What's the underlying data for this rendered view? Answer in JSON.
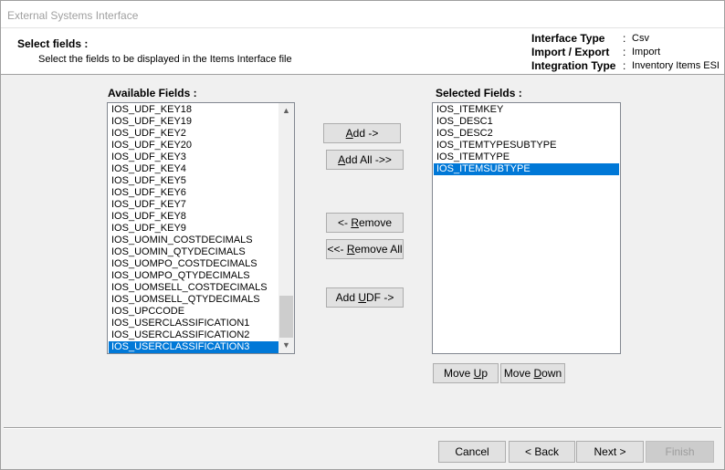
{
  "window": {
    "title": "External Systems Interface"
  },
  "header": {
    "title": "Select fields :",
    "subtitle": "Select the fields to be displayed in the Items Interface file",
    "info": [
      {
        "label": "Interface Type",
        "separator": ":",
        "value": "Csv"
      },
      {
        "label": "Import / Export",
        "separator": ":",
        "value": "Import"
      },
      {
        "label": "Integration Type",
        "separator": ":",
        "value": "Inventory Items ESI"
      }
    ]
  },
  "available": {
    "label": "Available Fields :",
    "items": [
      "IOS_UDF_KEY18",
      "IOS_UDF_KEY19",
      "IOS_UDF_KEY2",
      "IOS_UDF_KEY20",
      "IOS_UDF_KEY3",
      "IOS_UDF_KEY4",
      "IOS_UDF_KEY5",
      "IOS_UDF_KEY6",
      "IOS_UDF_KEY7",
      "IOS_UDF_KEY8",
      "IOS_UDF_KEY9",
      "IOS_UOMIN_COSTDECIMALS",
      "IOS_UOMIN_QTYDECIMALS",
      "IOS_UOMPO_COSTDECIMALS",
      "IOS_UOMPO_QTYDECIMALS",
      "IOS_UOMSELL_COSTDECIMALS",
      "IOS_UOMSELL_QTYDECIMALS",
      "IOS_UPCCODE",
      "IOS_USERCLASSIFICATION1",
      "IOS_USERCLASSIFICATION2",
      "IOS_USERCLASSIFICATION3"
    ],
    "selected_index": 20,
    "scroll_position": 1.0
  },
  "selected": {
    "label": "Selected Fields :",
    "items": [
      "IOS_ITEMKEY",
      "IOS_DESC1",
      "IOS_DESC2",
      "IOS_ITEMTYPESUBTYPE",
      "IOS_ITEMTYPE",
      "IOS_ITEMSUBTYPE"
    ],
    "selected_index": 5
  },
  "buttons": {
    "add": {
      "pre": "",
      "u": "A",
      "post": "dd ->"
    },
    "add_all": {
      "pre": "",
      "u": "A",
      "post": "dd All ->>"
    },
    "remove": {
      "pre": "<- ",
      "u": "R",
      "post": "emove"
    },
    "remove_all": {
      "pre": "<<- ",
      "u": "R",
      "post": "emove All"
    },
    "add_udf": {
      "pre": "Add ",
      "u": "U",
      "post": "DF ->"
    },
    "move_up": {
      "pre": "Move ",
      "u": "U",
      "post": "p"
    },
    "move_down": {
      "pre": "Move ",
      "u": "D",
      "post": "own"
    },
    "cancel": "Cancel",
    "back": "< Back",
    "next": "Next >",
    "finish": "Finish"
  },
  "colors": {
    "selection": "#0078d7"
  }
}
